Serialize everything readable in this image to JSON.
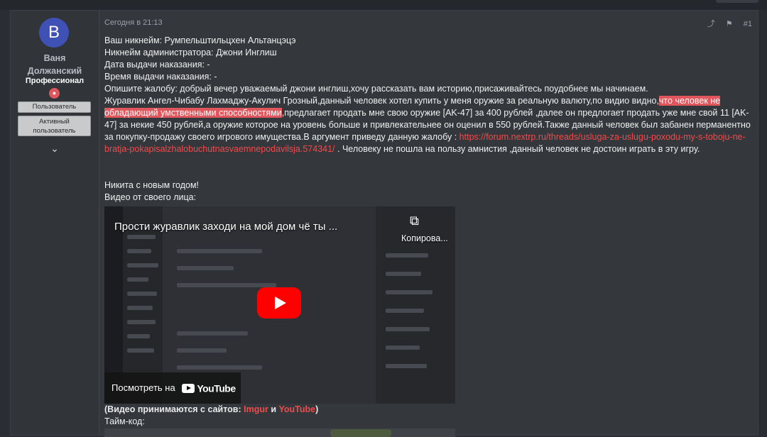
{
  "user": {
    "avatar_letter": "B",
    "name_line1": "Ваня",
    "name_line2": "Должанский",
    "title": "Профессионал",
    "banner_user": "Пользователь",
    "banner_active": "Активный пользователь"
  },
  "post": {
    "date": "Сегодня в 21:13",
    "number": "#1",
    "lines": {
      "nickname": "Ваш никнейм: Румпельштильцхен Альтанцэцэ",
      "admin": "Никнейм администратора: Джони Инглиш",
      "date_punish": "Дата выдачи наказания: -",
      "time_punish": "Время выдачи наказания: -",
      "complaint": "Опишите жалобу: добрый вечер уважаемый джони инглиш,хочу рассказать вам историю,присаживайтесь поудобнее мы начинаем.",
      "story_a": "Журавлик Ангел-Чибабу Лахмаджу-Акулич Грозный,данный человек хотел купить у меня оружие за реальную валюту,по видио видно,",
      "story_highlight": "что человек не обладающий умственными способностями",
      "story_b": ",предлагает продать мне свою оружие [AK-47] за 400 рублей ,далее он предлогает продать уже мне свой 11 [AK-47] за некие 450 рублей,а оружие которое на уровень больше и привлекательнее он оценил в 550 рублей.Также данный человек был забанен перманентно за покупку-продажу своего игрового имущества.В аргумент приведу данную жалобу : ",
      "story_link": "https://forum.nextrp.ru/threads/usluga-za-uslugu-poxodu-my-s-toboju-ne-bratja-pokapisalzhalobuchutnasvaemnepodavilsja.574341/",
      "story_c": " . Человеку не пошла на пользу амнистия ,данный человек не достоин играть в эту игру.",
      "greeting": "Никита с новым годом!",
      "video_label": "Видео от своего лица:"
    },
    "video": {
      "title": "Прости журавлик заходи на мой дом чё ты ...",
      "copy_label": "Копирова...",
      "watch_label": "Посмотреть на",
      "yt_word": "YouTube"
    },
    "note": {
      "open": "(Видео принимаются с сайтов: ",
      "imgur": "Imgur",
      "and": " и ",
      "youtube": "YouTube",
      "close": ")"
    },
    "timecode": "Тайм-код:"
  },
  "colors": {
    "accent": "#e0565d",
    "link": "#f04b4b",
    "avatar": "#3f51b5"
  }
}
